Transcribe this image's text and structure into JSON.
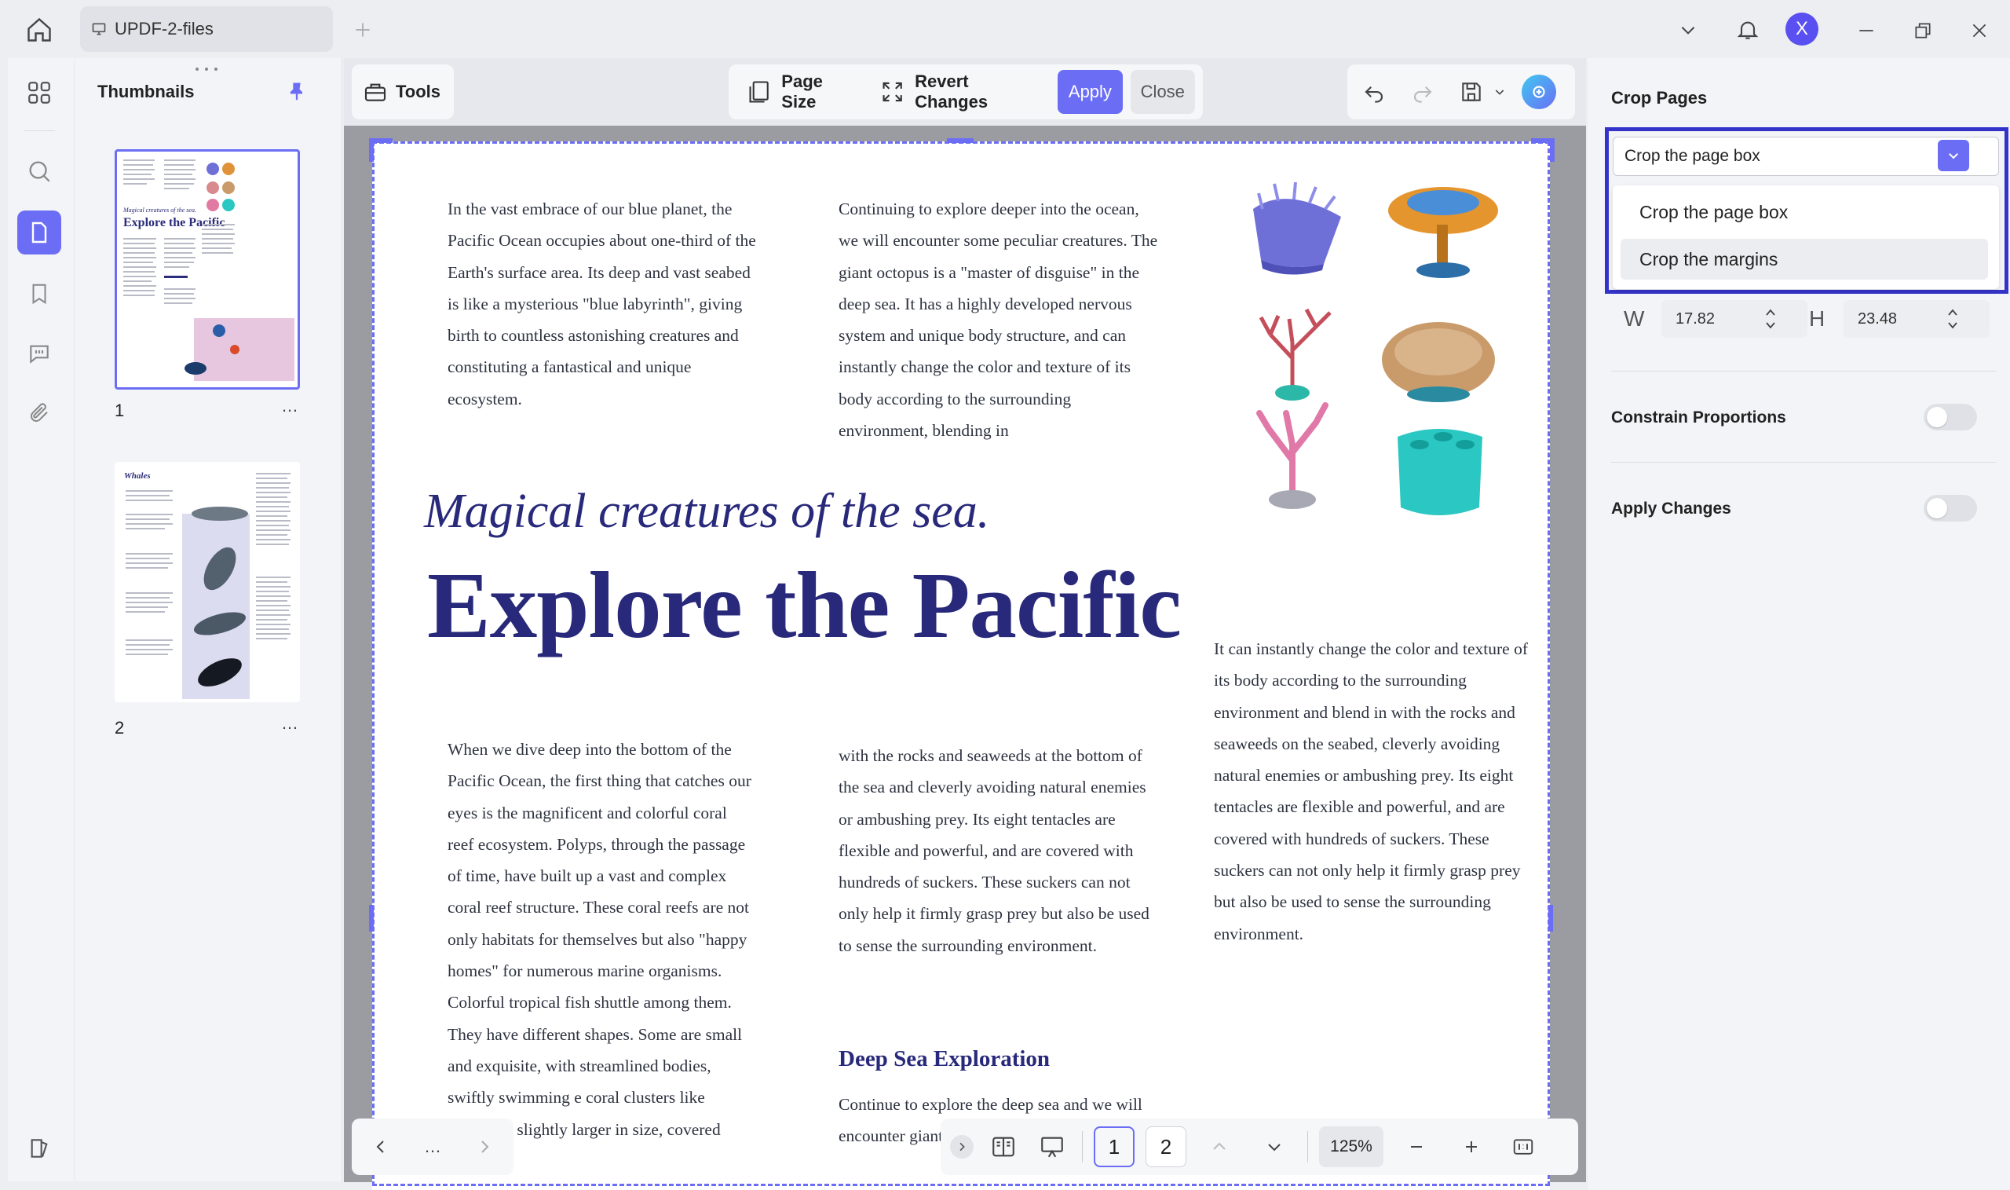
{
  "titlebar": {
    "tab_label": "UPDF-2-files",
    "user_initial": "X"
  },
  "thumbnails": {
    "title": "Thumbnails",
    "pages": [
      {
        "number": "1",
        "mini_title_small": "Magical creatures of the sea.",
        "mini_title": "Explore the Pacific"
      },
      {
        "number": "2",
        "mini_title": "Whales"
      }
    ],
    "more": "…"
  },
  "toolbar": {
    "tools": "Tools",
    "page_size": "Page Size",
    "revert_changes": "Revert Changes",
    "apply": "Apply",
    "close": "Close"
  },
  "document": {
    "col1_top": "In the vast embrace of our blue planet, the Pacific Ocean occupies about one-third of the Earth's surface area. Its deep and vast seabed is like a mysterious \"blue labyrinth\", giving birth to countless astonishing creatures and constituting a fantastical and unique ecosystem.",
    "col2_top": "Continuing to explore deeper into the ocean, we will encounter some peculiar creatures. The giant octopus is a \"master of disguise\" in the deep sea. It has a highly developed nervous system and unique body structure, and can instantly change the color and texture of its body according to the surrounding environment, blending in",
    "subtitle": "Magical creatures of the sea.",
    "title": "Explore the Pacific",
    "col3_mid": "It can instantly change the color and texture of its body according to the surrounding environment and blend in with the rocks and seaweeds on the seabed, cleverly avoiding natural enemies or ambushing prey. Its eight tentacles are flexible and powerful, and are covered with hundreds of suckers. These suckers can not only help it firmly grasp prey but also be used to sense the surrounding environment.",
    "col1_bottom": "When we dive deep into the bottom of the Pacific Ocean, the first thing that catches our eyes is the magnificent and colorful coral reef ecosystem. Polyps, through the passage of time, have built up a vast and complex coral reef structure. These coral reefs are not only habitats for themselves but also \"happy homes\" for numerous marine organisms. Colorful tropical fish shuttle among them. They have different shapes. Some are small and exquisite, with streamlined bodies, swiftly swimming e coral clusters like lightning. slightly larger in size, covered",
    "col2_bottom": "with the rocks and seaweeds at the bottom of the sea and cleverly avoiding natural enemies or ambushing prey. Its eight tentacles are flexible and powerful, and are covered with hundreds of suckers. These suckers can not only help it firmly grasp prey but also be used to sense the surrounding environment.",
    "section_heading": "Deep Sea Exploration",
    "col2_section": "Continue to explore the deep sea and we will encounter giant octopus i"
  },
  "panel": {
    "title": "Crop Pages",
    "select_value": "Crop the page box",
    "options": [
      "Crop the page box",
      "Crop the margins"
    ],
    "w_label": "W",
    "w_value": "17.82",
    "h_label": "H",
    "h_value": "23.48",
    "constrain": "Constrain Proportions",
    "apply_changes": "Apply Changes",
    "constrain_on": false,
    "apply_changes_on": false
  },
  "bottombar": {
    "more": "…",
    "page1": "1",
    "page2": "2",
    "zoom": "125%"
  },
  "colors": {
    "accent": "#6b6ef5",
    "title_navy": "#28297a",
    "dashed_border": "#6b6ef5"
  }
}
